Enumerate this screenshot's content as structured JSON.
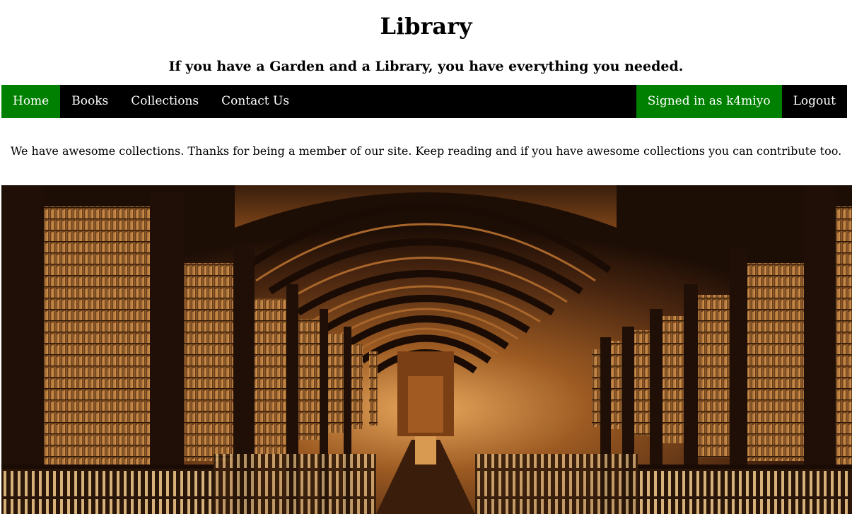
{
  "header": {
    "title": "Library",
    "tagline": "If you have a Garden and a Library, you have everything you needed."
  },
  "nav": {
    "items": [
      {
        "label": "Home",
        "active": true
      },
      {
        "label": "Books",
        "active": false
      },
      {
        "label": "Collections",
        "active": false
      },
      {
        "label": "Contact Us",
        "active": false
      }
    ],
    "signed_in": "Signed in as k4miyo",
    "logout": "Logout"
  },
  "intro": "We have awesome collections. Thanks for being a member of our site. Keep reading and if you have awesome collections you can contribute too.",
  "colors": {
    "nav_bg": "#000000",
    "active_bg": "#008000"
  },
  "hero": {
    "subject": "library-hall-photo"
  }
}
